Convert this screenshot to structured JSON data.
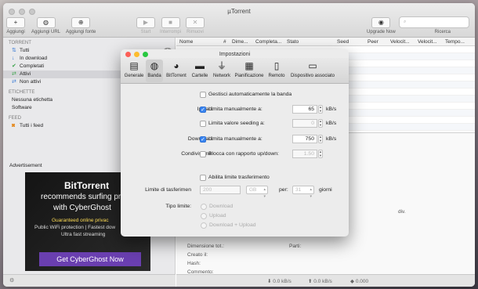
{
  "window": {
    "title": "µTorrent"
  },
  "toolbar": {
    "add": "Aggiungi",
    "add_url": "Aggiungi URL",
    "add_feed": "Aggiungi fonte",
    "start": "Start",
    "stop": "Interrompi",
    "remove": "Rimuovi",
    "upgrade": "Upgrade Now",
    "search_label": "Ricerca",
    "search_placeholder": ""
  },
  "sidebar": {
    "torrent_header": "TORRENT",
    "items": [
      {
        "label": "Tutti",
        "icon": "arrows-updown-icon"
      },
      {
        "label": "In download",
        "icon": "arrow-down-icon"
      },
      {
        "label": "Completati",
        "icon": "checkmark-icon"
      },
      {
        "label": "Attivi",
        "icon": "swap-icon"
      },
      {
        "label": "Non attivi",
        "icon": "swap-inactive-icon"
      }
    ],
    "labels_header": "ETICHETTE",
    "labels": [
      {
        "label": "Nessuna etichetta"
      },
      {
        "label": "Software"
      }
    ],
    "feed_header": "FEED",
    "feeds": [
      {
        "label": "Tutti i feed",
        "icon": "rss-icon"
      }
    ],
    "badge": "1"
  },
  "ad": {
    "label": "Advertisement",
    "brand": "BitTorrent",
    "line1": "recommends surfing pr",
    "line2": "with CyberGhost",
    "small1": "Guaranteed online privac",
    "small2": "Public WiFi protection | Fastest dow",
    "small3": "Ultra fast streaming",
    "cta": "Get CyberGhost Now"
  },
  "table": {
    "columns": [
      "Nome",
      "#",
      "Dime...",
      "Completa...",
      "Stato",
      "Seed",
      "Peer",
      "Velocit...",
      "Velocit...",
      "Tempo..."
    ]
  },
  "details": {
    "size": "Dimensione tot.:",
    "parts": "Parti:",
    "created": "Creato il:",
    "hash": "Hash:",
    "comment": "Commento:",
    "trunc": "div."
  },
  "status": {
    "down": "0.0 kB/s",
    "up": "0.0 kB/s",
    "value": "0.000"
  },
  "prefs": {
    "title": "Impostazioni",
    "tabs": [
      {
        "label": "Generale",
        "icon": "general-icon"
      },
      {
        "label": "Banda",
        "icon": "bandwidth-icon"
      },
      {
        "label": "BitTorrent",
        "icon": "bittorrent-icon"
      },
      {
        "label": "Cartelle",
        "icon": "folder-icon"
      },
      {
        "label": "Network",
        "icon": "plug-icon"
      },
      {
        "label": "Pianificazione",
        "icon": "calendar-icon"
      },
      {
        "label": "Remoto",
        "icon": "remote-icon"
      },
      {
        "label": "Dispositivo associato",
        "icon": "monitor-icon"
      }
    ],
    "auto_manage": "Gestisci automaticamente la banda",
    "upload_label": "Ipload:",
    "upload_limit": "Limita manualmente a:",
    "upload_value": "65",
    "upload_unit": "kB/s",
    "seed_limit": "Limita valore seeding a:",
    "seed_value": "0",
    "seed_unit": "kB/s",
    "download_label": "Download:",
    "download_limit": "Limita manualmente a:",
    "download_value": "750",
    "download_unit": "kB/s",
    "condition_label": "Condivisione:",
    "ratio_block": "Blocca con rapporto up/down:",
    "ratio_value": "1.50",
    "transfer_enable": "Abilita limite trasferimento",
    "transfer_label": "Limite di tasferimen",
    "transfer_value": "200",
    "transfer_unit": "GB",
    "per_label": "per:",
    "per_value": "31",
    "per_unit": "giorni",
    "limit_type_label": "Tipo limite:",
    "limit_options": [
      "Download",
      "Upload",
      "Download + Upload"
    ]
  }
}
